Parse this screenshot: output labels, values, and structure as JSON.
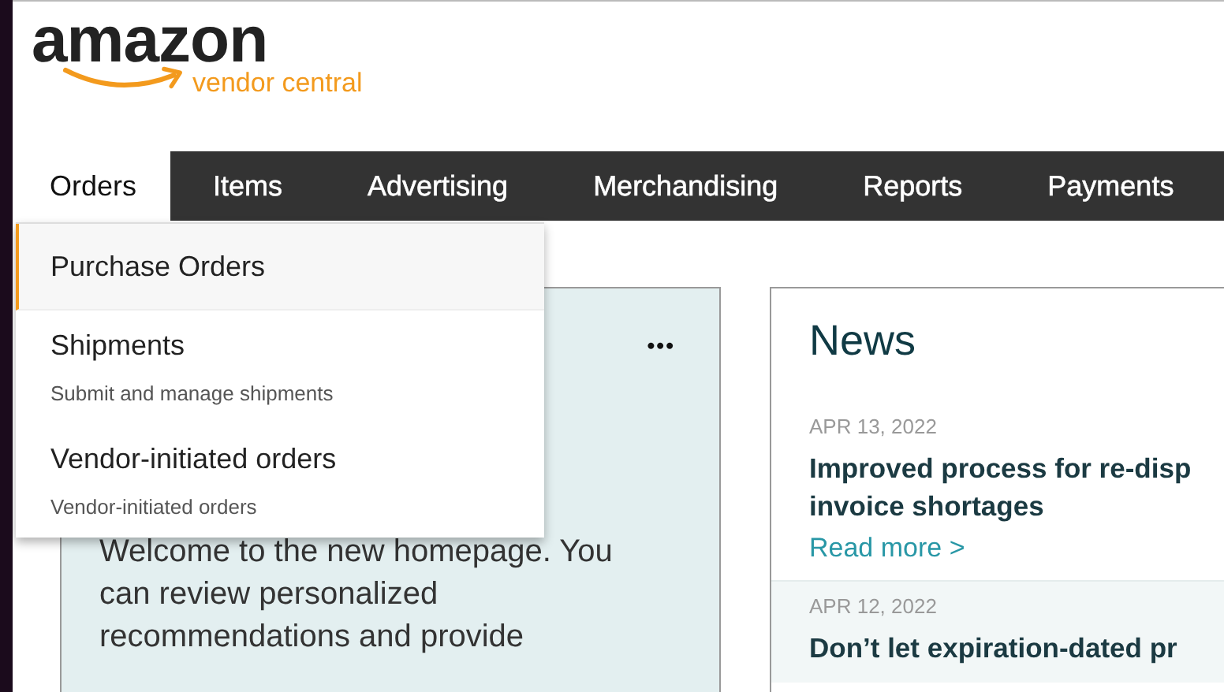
{
  "logo": {
    "wordmark": "amazon",
    "subtitle": "vendor central"
  },
  "nav": [
    {
      "label": "Orders",
      "selected": true
    },
    {
      "label": "Items",
      "selected": false
    },
    {
      "label": "Advertising",
      "selected": false
    },
    {
      "label": "Merchandising",
      "selected": false
    },
    {
      "label": "Reports",
      "selected": false
    },
    {
      "label": "Payments",
      "selected": false
    }
  ],
  "dropdown": [
    {
      "title": "Purchase Orders",
      "selected": true
    },
    {
      "title": "Shipments",
      "description": "Submit and manage shipments",
      "selected": false
    },
    {
      "title": "Vendor-initiated orders",
      "description": "Vendor-initiated orders",
      "selected": false
    }
  ],
  "welcome_card": {
    "menu": "•••",
    "text": "Welcome to the new homepage. You can review personalized recommendations and provide"
  },
  "news": {
    "title": "News",
    "items": [
      {
        "date": "APR 13, 2022",
        "headline": "Improved process for re-disp\ninvoice shortages",
        "link": "Read more >",
        "highlighted": false
      },
      {
        "date": "APR 12, 2022",
        "headline": "Don’t let expiration-dated pr",
        "highlighted": true
      }
    ]
  }
}
